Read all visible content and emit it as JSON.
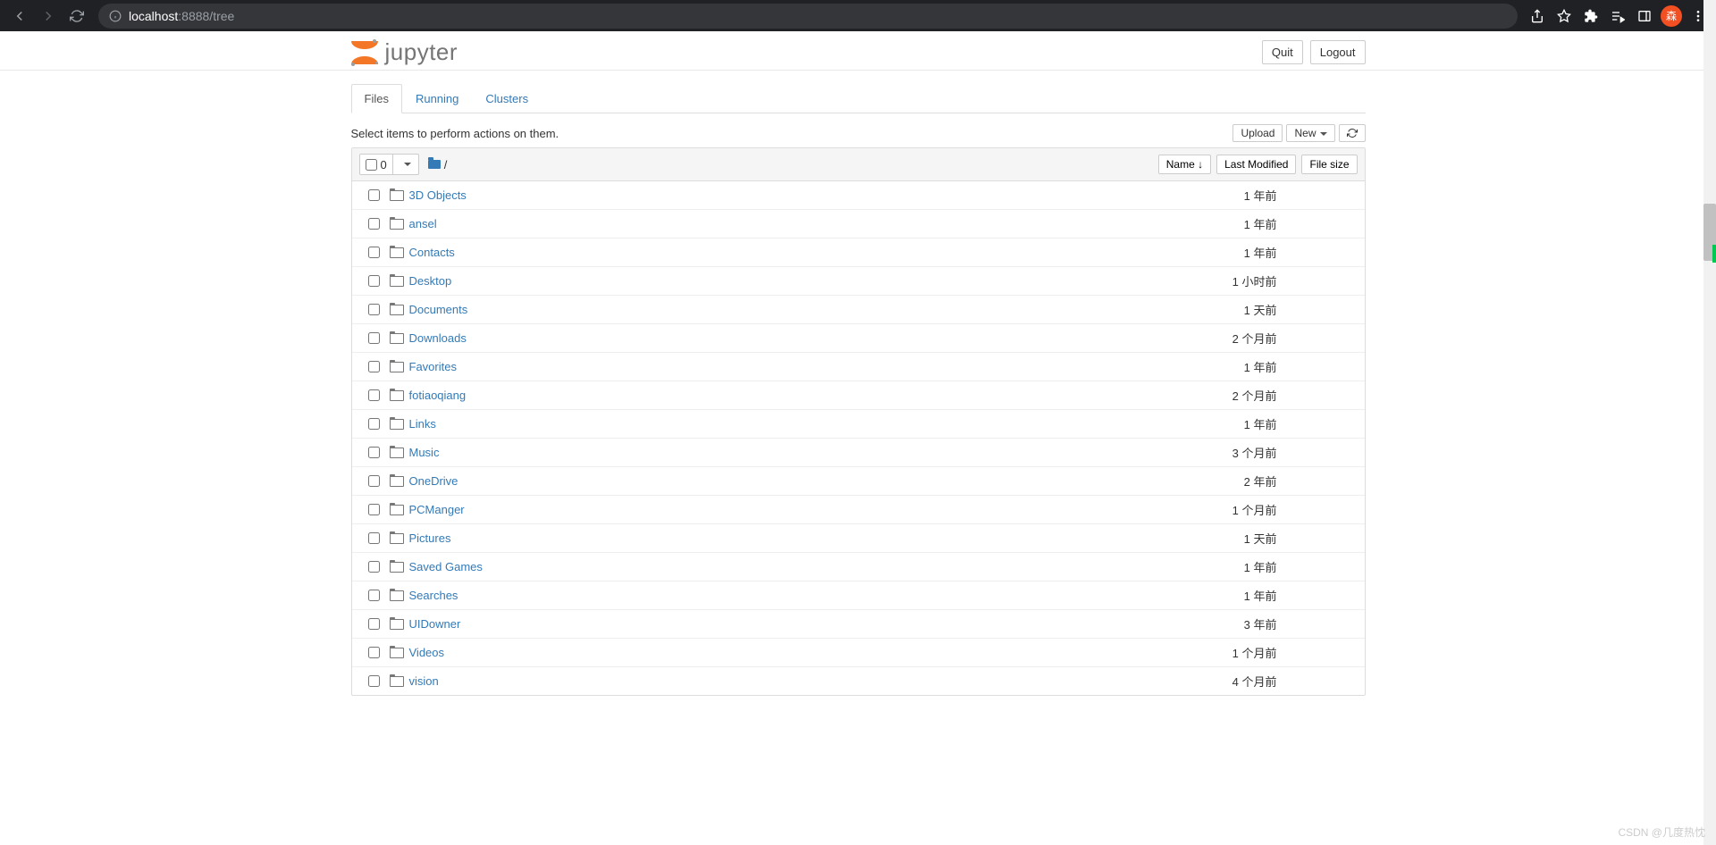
{
  "browser": {
    "url_host": "localhost",
    "url_port_path": ":8888/tree"
  },
  "profile_initial": "森",
  "header": {
    "logo_text": "jupyter",
    "quit": "Quit",
    "logout": "Logout"
  },
  "tabs": [
    {
      "label": "Files",
      "active": true
    },
    {
      "label": "Running",
      "active": false
    },
    {
      "label": "Clusters",
      "active": false
    }
  ],
  "toolbar": {
    "hint": "Select items to perform actions on them.",
    "upload": "Upload",
    "new": "New",
    "refresh_title": "Refresh"
  },
  "list_header": {
    "selected_count": "0",
    "breadcrumb_root": "/",
    "name_col": "Name",
    "modified_col": "Last Modified",
    "size_col": "File size"
  },
  "items": [
    {
      "name": "3D Objects",
      "modified": "1 年前",
      "size": ""
    },
    {
      "name": "ansel",
      "modified": "1 年前",
      "size": ""
    },
    {
      "name": "Contacts",
      "modified": "1 年前",
      "size": ""
    },
    {
      "name": "Desktop",
      "modified": "1 小时前",
      "size": ""
    },
    {
      "name": "Documents",
      "modified": "1 天前",
      "size": ""
    },
    {
      "name": "Downloads",
      "modified": "2 个月前",
      "size": ""
    },
    {
      "name": "Favorites",
      "modified": "1 年前",
      "size": ""
    },
    {
      "name": "fotiaoqiang",
      "modified": "2 个月前",
      "size": ""
    },
    {
      "name": "Links",
      "modified": "1 年前",
      "size": ""
    },
    {
      "name": "Music",
      "modified": "3 个月前",
      "size": ""
    },
    {
      "name": "OneDrive",
      "modified": "2 年前",
      "size": ""
    },
    {
      "name": "PCManger",
      "modified": "1 个月前",
      "size": ""
    },
    {
      "name": "Pictures",
      "modified": "1 天前",
      "size": ""
    },
    {
      "name": "Saved Games",
      "modified": "1 年前",
      "size": ""
    },
    {
      "name": "Searches",
      "modified": "1 年前",
      "size": ""
    },
    {
      "name": "UIDowner",
      "modified": "3 年前",
      "size": ""
    },
    {
      "name": "Videos",
      "modified": "1 个月前",
      "size": ""
    },
    {
      "name": "vision",
      "modified": "4 个月前",
      "size": ""
    }
  ],
  "watermark": "CSDN @几度热忱"
}
